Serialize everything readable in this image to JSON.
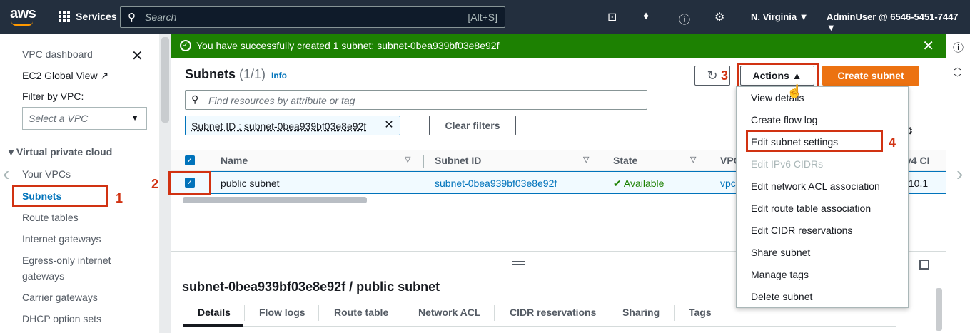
{
  "topbar": {
    "logo": "aws",
    "services_label": "Services",
    "search_placeholder": "Search",
    "search_shortcut": "[Alt+S]",
    "region": "N. Virginia ▼",
    "account": "AdminUser @ 6546-5451-7447 ▼"
  },
  "sidebar": {
    "vpc_dashboard": "VPC dashboard",
    "ec2_global_view": "EC2 Global View",
    "filter_label": "Filter by VPC:",
    "select_placeholder": "Select a VPC",
    "section": "Virtual private cloud",
    "items": [
      "Your VPCs",
      "Subnets",
      "Route tables",
      "Internet gateways",
      "Egress-only internet",
      "gateways",
      "Carrier gateways",
      "DHCP option sets"
    ]
  },
  "banner": {
    "message": "You have successfully created 1 subnet: subnet-0bea939bf03e8e92f"
  },
  "main": {
    "title": "Subnets",
    "count": "(1/1)",
    "info": "Info",
    "actions_label": "Actions ▲",
    "create_label": "Create subnet",
    "find_placeholder": "Find resources by attribute or tag",
    "filter_token": "Subnet ID : subnet-0bea939bf03e8e92f",
    "clear_filters": "Clear filters",
    "columns": [
      "Name",
      "Subnet ID",
      "State",
      "VPC",
      "v4 CI"
    ],
    "row": {
      "name": "public subnet",
      "subnet_id": "subnet-0bea939bf03e8e92f",
      "state": "Available",
      "vpc": "vpc",
      "cidr": ".10.1"
    },
    "detail_title": "subnet-0bea939bf03e8e92f / public subnet",
    "tabs": [
      "Details",
      "Flow logs",
      "Route table",
      "Network ACL",
      "CIDR reservations",
      "Sharing",
      "Tags"
    ]
  },
  "dropdown": {
    "items": [
      "View details",
      "Create flow log",
      "Edit subnet settings",
      "Edit IPv6 CIDRs",
      "Edit network ACL association",
      "Edit route table association",
      "Edit CIDR reservations",
      "Share subnet",
      "Manage tags",
      "Delete subnet"
    ]
  },
  "annotations": [
    "1",
    "2",
    "3",
    "4"
  ],
  "colors": {
    "topbar": "#232f3e",
    "success": "#1d8102",
    "primary": "#ec7211",
    "link": "#0073bb",
    "annotation": "#d13212"
  }
}
